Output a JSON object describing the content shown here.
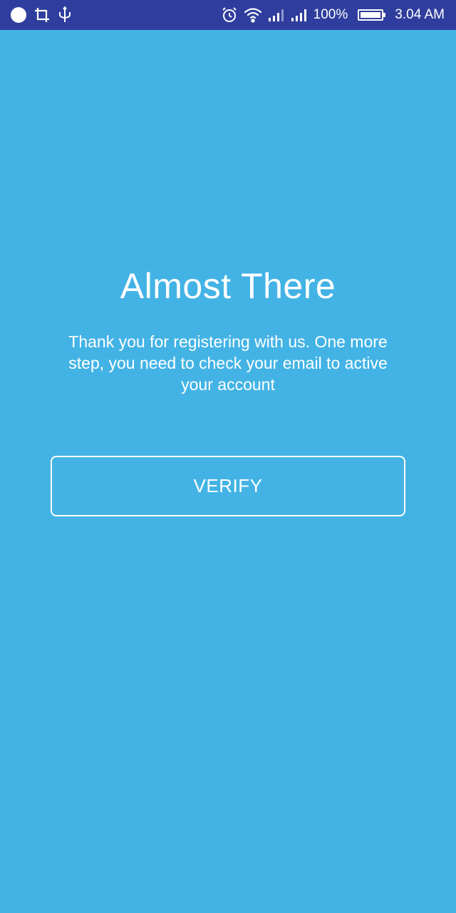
{
  "status_bar": {
    "left_icons": [
      "record-dot-icon",
      "crop-icon",
      "usb-icon"
    ],
    "right_icons": [
      "alarm-icon",
      "wifi-icon",
      "signal-icon",
      "signal-icon"
    ],
    "battery_percent": "100%",
    "battery_level": 1.0,
    "time": "3.04 AM"
  },
  "main": {
    "title": "Almost There",
    "message": "Thank you for registering with us. One more step, you need to check your email to active your account",
    "verify_label": "VERIFY"
  },
  "colors": {
    "background": "#43b3e5",
    "status_bar": "#2f3e9e",
    "text": "#ffffff"
  }
}
